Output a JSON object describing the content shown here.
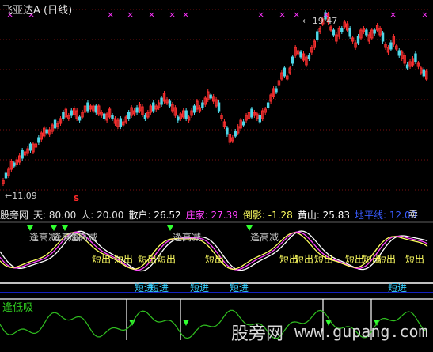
{
  "header": {
    "title": "飞亚达A (日线)"
  },
  "chart": {
    "high_label": "← 19.47",
    "low_label": "←11.09",
    "signal_s": "S",
    "top_marker_glyph": "×",
    "top_marker_color": "#ff33ff",
    "up_color": "#ff3030",
    "down_color": "#4fd8e8"
  },
  "indicator_row": {
    "items": [
      {
        "text": "股旁网",
        "color": "#e0e0e0"
      },
      {
        "text": "天: 80.00",
        "color": "#e0e0e0"
      },
      {
        "text": "人: 20.00",
        "color": "#e0e0e0"
      },
      {
        "text": "散户: 26.52",
        "color": "#ffffff"
      },
      {
        "text": "庄家: 27.39",
        "color": "#ff40ff"
      },
      {
        "text": "倒影: -1.28",
        "color": "#ffff60"
      },
      {
        "text": "黄山: 25.83",
        "color": "#ffffff"
      },
      {
        "text": "地平线: 12.00",
        "color": "#3a5cff"
      }
    ],
    "right_glyph": "卖"
  },
  "signals": {
    "high_reduce_label": "逢高减",
    "short_out_label": "短出",
    "short_in_label": "短进",
    "low_buy_label": "逢低吸"
  },
  "watermark": {
    "text": "股旁网",
    "url": "www.gupang.com"
  }
}
